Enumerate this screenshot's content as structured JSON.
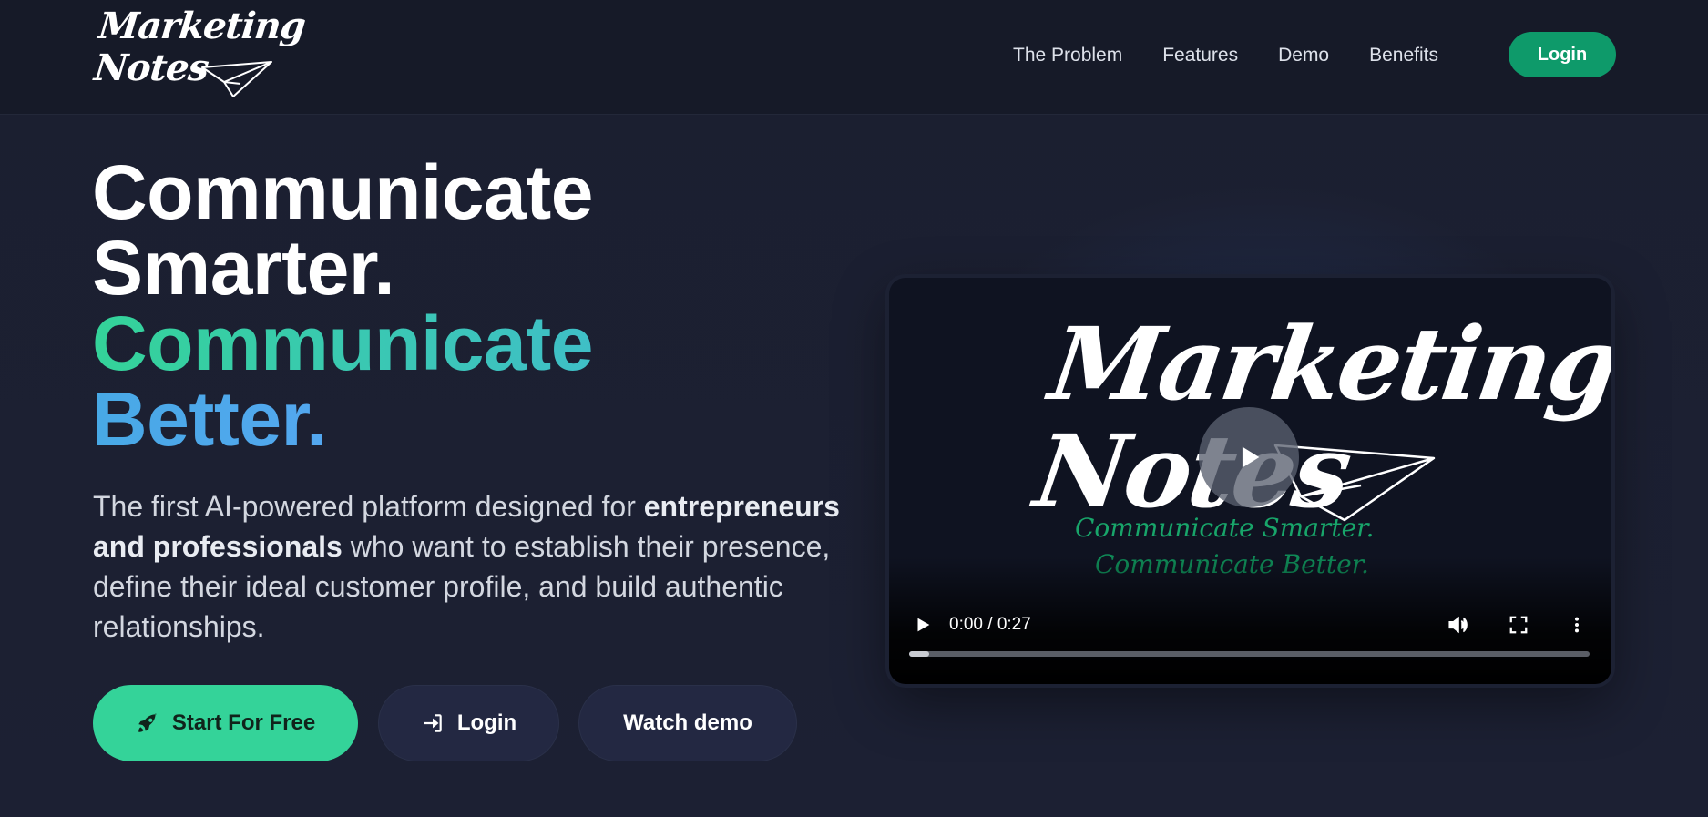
{
  "brand": {
    "logo_line1": "Marketing",
    "logo_line2": "Notes"
  },
  "nav": {
    "links": [
      "The Problem",
      "Features",
      "Demo",
      "Benefits"
    ],
    "login_label": "Login"
  },
  "hero": {
    "headline_line1": "Communicate",
    "headline_line2": "Smarter.",
    "headline_line3": "Communicate",
    "headline_line4": "Better.",
    "sub_part1": "The first AI-powered platform designed for",
    "sub_bold": "entrepreneurs and professionals",
    "sub_part2": "who want to establish their presence, define their ideal customer profile, and build authentic relationships.",
    "cta_primary": "Start For Free",
    "cta_login": "Login",
    "cta_demo": "Watch demo"
  },
  "video": {
    "logo_line1": "Marketing",
    "logo_line2": "Notes",
    "tagline1": "Communicate Smarter.",
    "tagline2": "Communicate Better.",
    "time": "0:00 / 0:27",
    "progress": 0.03
  },
  "colors": {
    "accent_green": "#34d399",
    "nav_login_bg": "#0e9a6a",
    "accent_blue": "#60a5fa",
    "background": "#1a1e2e"
  }
}
